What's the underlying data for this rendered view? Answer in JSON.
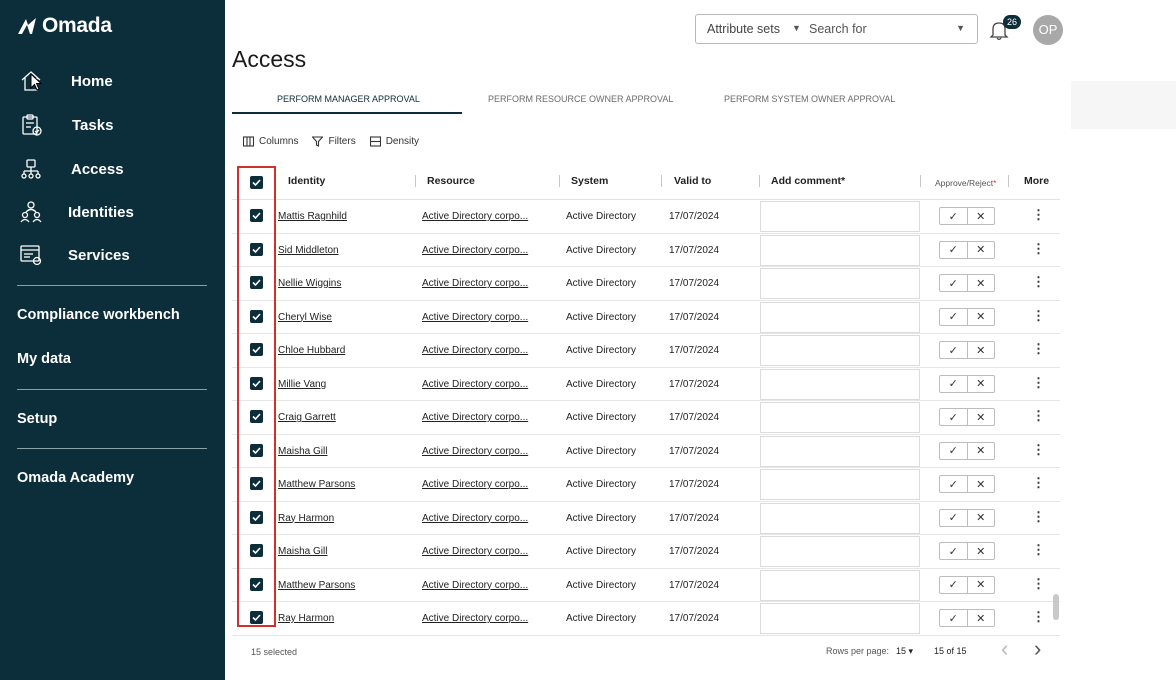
{
  "app": {
    "logo_text": "Omada"
  },
  "sidebar": {
    "nav": [
      {
        "label": "Home",
        "icon": "home-icon"
      },
      {
        "label": "Tasks",
        "icon": "tasks-icon"
      },
      {
        "label": "Access",
        "icon": "access-icon"
      },
      {
        "label": "Identities",
        "icon": "identities-icon"
      },
      {
        "label": "Services",
        "icon": "services-icon"
      }
    ],
    "sections": [
      {
        "label": "Compliance workbench"
      },
      {
        "label": "My data"
      },
      {
        "label": "Setup"
      },
      {
        "label": "Omada Academy"
      }
    ]
  },
  "header": {
    "attribute_sets": "Attribute sets",
    "search_placeholder": "Search for",
    "notifications_count": "26",
    "avatar_initials": "OP"
  },
  "page": {
    "title": "Access",
    "tabs": [
      {
        "label": "PERFORM MANAGER APPROVAL",
        "active": true
      },
      {
        "label": "PERFORM RESOURCE OWNER APPROVAL",
        "active": false
      },
      {
        "label": "PERFORM SYSTEM OWNER APPROVAL",
        "active": false
      }
    ]
  },
  "toolbar": {
    "columns": "Columns",
    "filters": "Filters",
    "density": "Density"
  },
  "table": {
    "columns": {
      "identity": "Identity",
      "resource": "Resource",
      "system": "System",
      "valid_to": "Valid to",
      "add_comment": "Add comment*",
      "approve_reject": "Approve/Reject",
      "required_mark": "*",
      "more": "More"
    },
    "rows": [
      {
        "identity": "Mattis Ragnhild",
        "resource": "Active Directory corpo...",
        "system": "Active Directory",
        "valid_to": "17/07/2024",
        "checked": true
      },
      {
        "identity": "Sid Middleton",
        "resource": "Active Directory corpo...",
        "system": "Active Directory",
        "valid_to": "17/07/2024",
        "checked": true
      },
      {
        "identity": "Nellie Wiggins",
        "resource": "Active Directory corpo...",
        "system": "Active Directory",
        "valid_to": "17/07/2024",
        "checked": true
      },
      {
        "identity": "Cheryl Wise",
        "resource": "Active Directory corpo...",
        "system": "Active Directory",
        "valid_to": "17/07/2024",
        "checked": true
      },
      {
        "identity": "Chloe Hubbard",
        "resource": "Active Directory corpo...",
        "system": "Active Directory",
        "valid_to": "17/07/2024",
        "checked": true
      },
      {
        "identity": "Millie Vang",
        "resource": "Active Directory corpo...",
        "system": "Active Directory",
        "valid_to": "17/07/2024",
        "checked": true
      },
      {
        "identity": "Craig Garrett",
        "resource": "Active Directory corpo...",
        "system": "Active Directory",
        "valid_to": "17/07/2024",
        "checked": true
      },
      {
        "identity": "Maisha Gill",
        "resource": "Active Directory corpo...",
        "system": "Active Directory",
        "valid_to": "17/07/2024",
        "checked": true
      },
      {
        "identity": "Matthew Parsons",
        "resource": "Active Directory corpo...",
        "system": "Active Directory",
        "valid_to": "17/07/2024",
        "checked": true
      },
      {
        "identity": "Ray Harmon",
        "resource": "Active Directory corpo...",
        "system": "Active Directory",
        "valid_to": "17/07/2024",
        "checked": true
      },
      {
        "identity": "Maisha Gill",
        "resource": "Active Directory corpo...",
        "system": "Active Directory",
        "valid_to": "17/07/2024",
        "checked": true
      },
      {
        "identity": "Matthew Parsons",
        "resource": "Active Directory corpo...",
        "system": "Active Directory",
        "valid_to": "17/07/2024",
        "checked": true
      },
      {
        "identity": "Ray Harmon",
        "resource": "Active Directory corpo...",
        "system": "Active Directory",
        "valid_to": "17/07/2024",
        "checked": true
      }
    ]
  },
  "footer": {
    "selected": "15 selected",
    "rows_per_page_label": "Rows per page:",
    "rows_per_page_value": "15 ▾",
    "range": "15 of 15"
  },
  "colors": {
    "sidebar_bg": "#0c2d3a",
    "highlight": "#d0312d"
  }
}
